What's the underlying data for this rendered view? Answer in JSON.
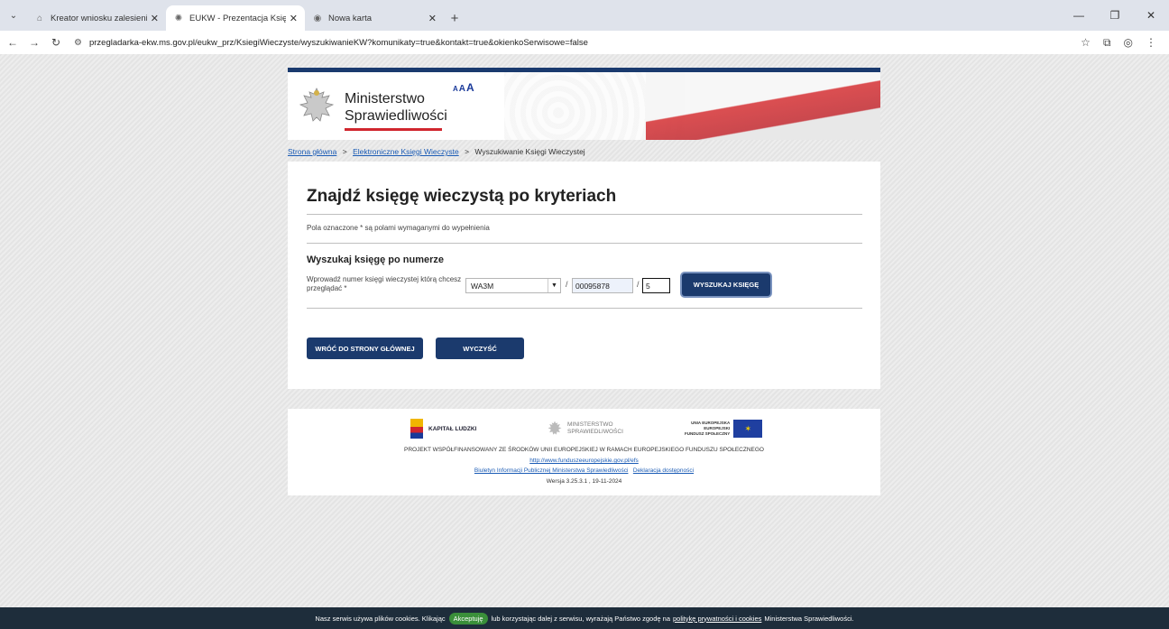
{
  "browser": {
    "tabs": [
      {
        "title": "Kreator wniosku zalesieniowego",
        "active": false
      },
      {
        "title": "EUKW - Prezentacja Księgi Wie",
        "active": true
      },
      {
        "title": "Nowa karta",
        "active": false
      }
    ],
    "new_tab": "+",
    "url": "przegladarka-ekw.ms.gov.pl/eukw_prz/KsiegiWieczyste/wyszukiwanieKW?komunikaty=true&kontakt=true&okienkoSerwisowe=false"
  },
  "header": {
    "ministry_line1": "Ministerstwo",
    "ministry_line2": "Sprawiedliwości",
    "font_size_a1": "A",
    "font_size_a2": "A",
    "font_size_a3": "A"
  },
  "breadcrumb": {
    "home": "Strona główna",
    "ekw": "Elektroniczne Księgi Wieczyste",
    "current": "Wyszukiwanie Księgi Wieczystej",
    "sep": ">"
  },
  "form": {
    "title": "Znajdź księgę wieczystą po kryteriach",
    "required_note": "Pola oznaczone * są polami wymaganymi do wypełnienia",
    "section_title": "Wyszukaj księgę po numerze",
    "number_label": "Wprowadź numer księgi wieczystej którą chcesz przeglądać *",
    "court_code": "WA3M",
    "book_number": "00095878",
    "check_digit": "5",
    "slash": "/",
    "search_button": "WYSZUKAJ KSIĘGĘ",
    "back_button": "WRÓĆ DO STRONY GŁÓWNEJ",
    "clear_button": "WYCZYŚĆ"
  },
  "footer": {
    "kl_logo": "KAPITAŁ LUDZKI",
    "ms_logo_line1": "MINISTERSTWO",
    "ms_logo_line2": "SPRAWIEDLIWOŚCI",
    "ue_logo_line1": "UNIA EUROPEJSKA",
    "ue_logo_line2": "EUROPEJSKI",
    "ue_logo_line3": "FUNDUSZ SPOŁECZNY",
    "project_text": "PROJEKT WSPÓŁFINANSOWANY ZE ŚRODKÓW UNII EUROPEJSKIEJ W RAMACH EUROPEJSKIEGO FUNDUSZU SPOŁECZNEGO",
    "efs_link": "http://www.funduszeeuropejskie.gov.pl/efs",
    "bip_link": "Biuletyn Informacji Publicznej Ministerstwa Sprawiedliwości",
    "accessibility_link": "Deklaracja dostępności",
    "version": "Wersja 3.25.3.1 , 19-11-2024"
  },
  "cookies": {
    "text_before": "Nasz serwis używa plików cookies. Klikając",
    "accept": "Akceptuję",
    "text_middle": "lub korzystając dalej z serwisu, wyrażają Państwo zgodę na",
    "policy_link": "politykę prywatności i cookies",
    "text_after": "Ministerstwa Sprawiedliwości."
  }
}
